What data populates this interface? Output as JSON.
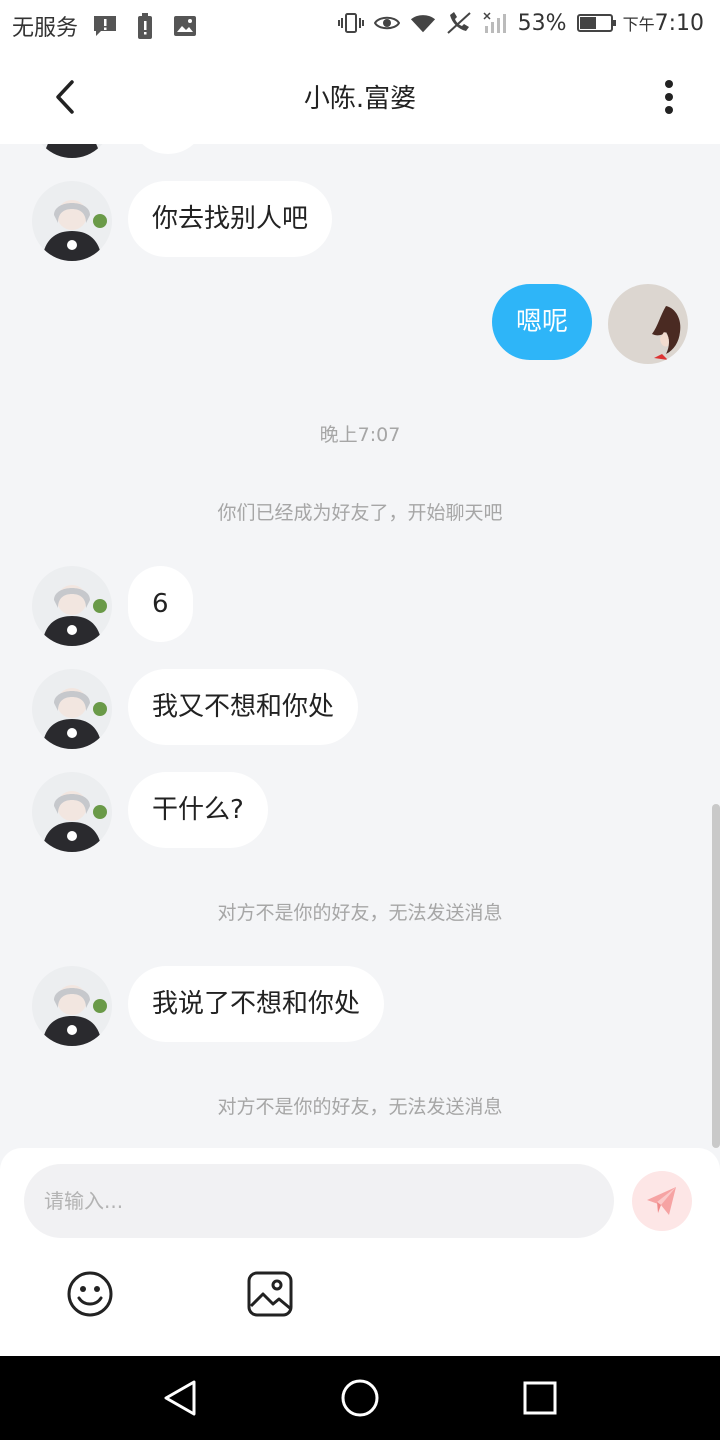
{
  "status_bar": {
    "carrier": "无服务",
    "battery_percent": "53%",
    "time_prefix": "下午",
    "time": "7:10",
    "battery_level": 0.53
  },
  "header": {
    "title": "小陈.富婆"
  },
  "messages": [
    {
      "side": "left",
      "text": "你去找别人吧"
    },
    {
      "side": "right",
      "text": "嗯呢"
    },
    {
      "side": "system",
      "text": "晚上7:07"
    },
    {
      "side": "system",
      "text": "你们已经成为好友了，开始聊天吧"
    },
    {
      "side": "left",
      "text": "6"
    },
    {
      "side": "left",
      "text": "我又不想和你处"
    },
    {
      "side": "left",
      "text": "干什么?"
    },
    {
      "side": "system",
      "text": "对方不是你的好友，无法发送消息"
    },
    {
      "side": "left",
      "text": "我说了不想和你处"
    },
    {
      "side": "system",
      "text": "对方不是你的好友，无法发送消息"
    }
  ],
  "input": {
    "placeholder": "请输入..."
  },
  "colors": {
    "accent": "#2eb5f8",
    "background": "#f4f5f7",
    "send_button": "#f6a3a3"
  }
}
